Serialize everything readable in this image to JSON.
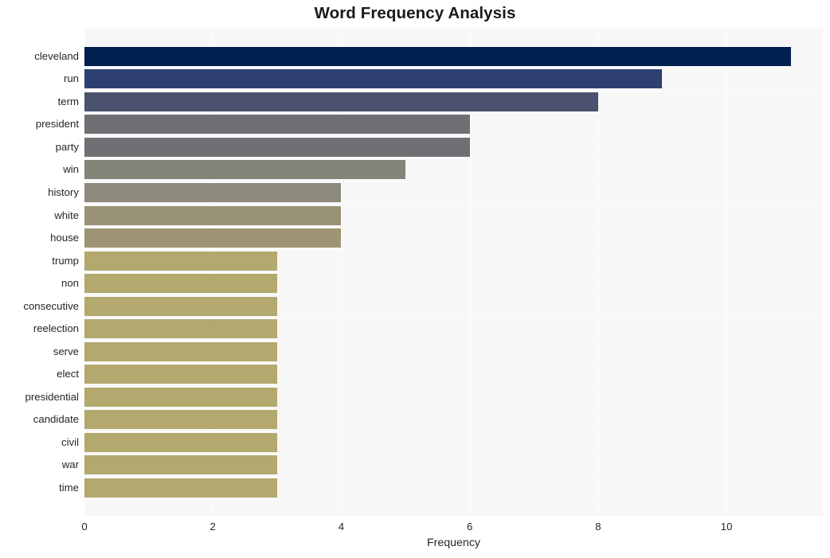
{
  "chart_data": {
    "type": "bar",
    "orientation": "horizontal",
    "title": "Word Frequency Analysis",
    "xlabel": "Frequency",
    "ylabel": "",
    "xlim": [
      0,
      11.5
    ],
    "xticks": [
      0,
      2,
      4,
      6,
      8,
      10
    ],
    "xticklabels": [
      "0",
      "2",
      "4",
      "6",
      "8",
      "10"
    ],
    "grid": true,
    "grid_axis": "both",
    "legend": null,
    "background": "#f7f7f7",
    "categories": [
      "cleveland",
      "run",
      "term",
      "president",
      "party",
      "win",
      "history",
      "white",
      "house",
      "trump",
      "non",
      "consecutive",
      "reelection",
      "serve",
      "elect",
      "presidential",
      "candidate",
      "civil",
      "war",
      "time"
    ],
    "values": [
      11,
      9,
      8,
      6,
      6,
      5,
      4,
      4,
      4,
      3,
      3,
      3,
      3,
      3,
      3,
      3,
      3,
      3,
      3,
      3
    ],
    "colors": [
      "#012050",
      "#2e4071",
      "#4a5270",
      "#6e7074",
      "#6e7073",
      "#858479",
      "#8c8a7b",
      "#9a9275",
      "#9c9474",
      "#b3a86e",
      "#b3a86e",
      "#b3a86e",
      "#b3a86e",
      "#b3a86e",
      "#b3a86e",
      "#b3a86e",
      "#b3a86e",
      "#b3a86e",
      "#b3a86e",
      "#b3a86e"
    ]
  }
}
